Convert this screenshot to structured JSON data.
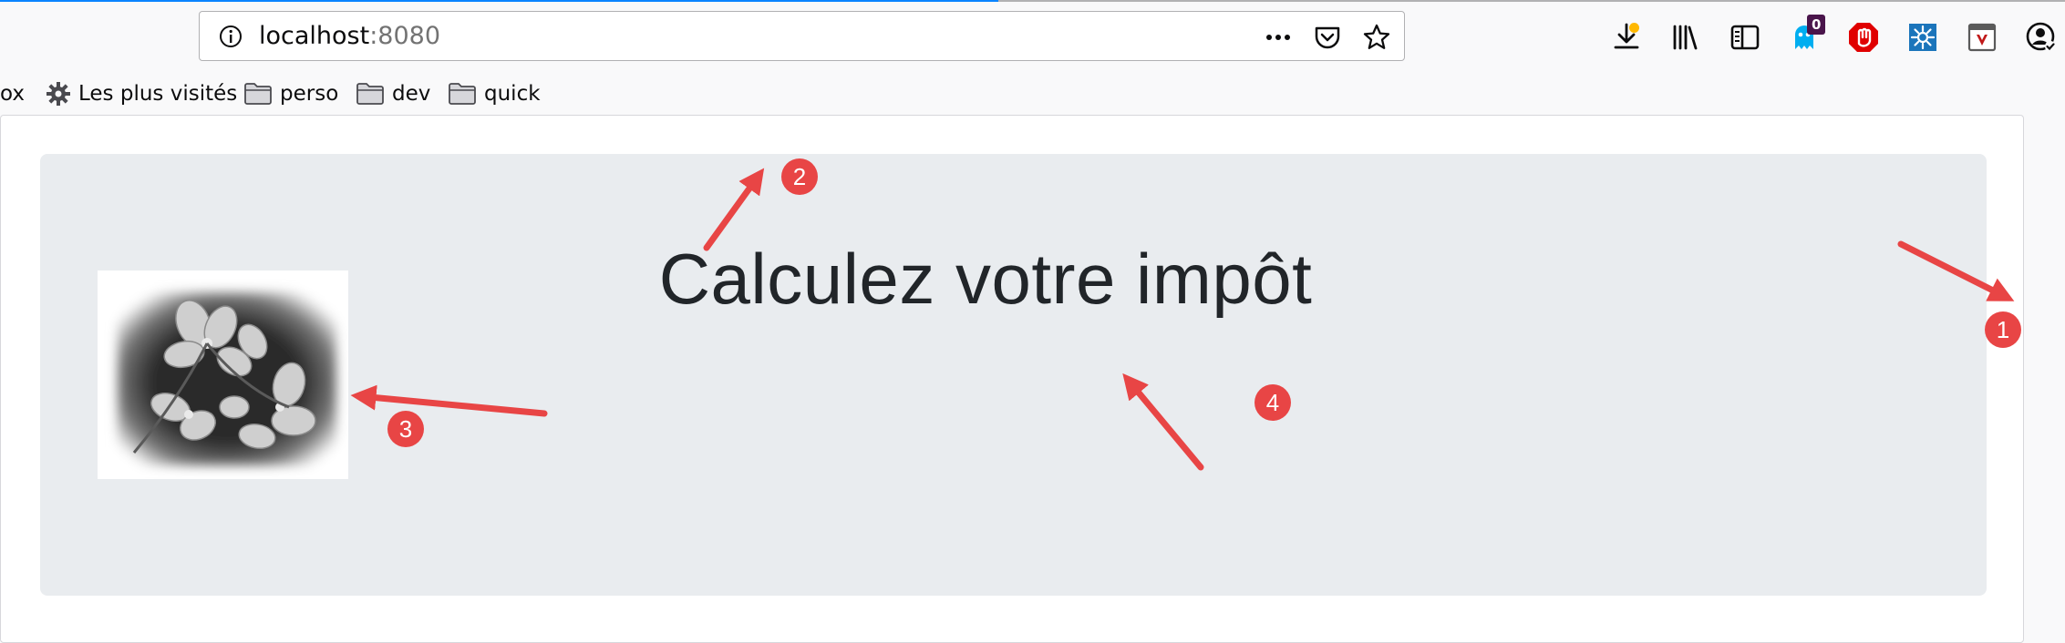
{
  "browser": {
    "url_host": "localhost",
    "url_port": ":8080",
    "toolbar_icons": [
      "download-icon",
      "library-icon",
      "sidebar-icon",
      "ghostery-icon",
      "ublock-icon",
      "extension-icon",
      "mcafee-icon",
      "account-icon"
    ],
    "ghostery_badge": "0"
  },
  "bookmarks": {
    "partial": "ox",
    "most_visited": "Les plus visités",
    "folder1": "perso",
    "folder2": "dev",
    "folder3": "quick"
  },
  "page": {
    "title": "Calculez votre impôt"
  },
  "annotations": {
    "m1": "1",
    "m2": "2",
    "m3": "3",
    "m4": "4"
  },
  "colors": {
    "jumbotron": "#e9ecef",
    "annotation": "#e84545"
  }
}
